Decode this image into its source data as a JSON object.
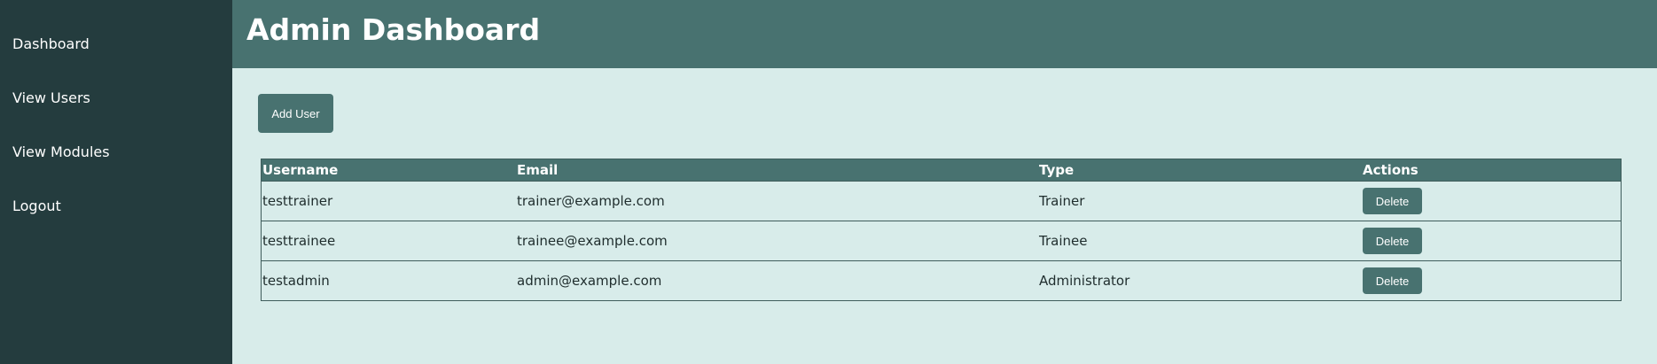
{
  "sidebar": {
    "items": [
      {
        "label": "Dashboard"
      },
      {
        "label": "View Users"
      },
      {
        "label": "View Modules"
      },
      {
        "label": "Logout"
      }
    ]
  },
  "header": {
    "title": "Admin Dashboard"
  },
  "toolbar": {
    "add_user_label": "Add User"
  },
  "table": {
    "columns": [
      "Username",
      "Email",
      "Type",
      "Actions"
    ],
    "rows": [
      {
        "username": "testtrainer",
        "email": "trainer@example.com",
        "type": "Trainer",
        "action_label": "Delete"
      },
      {
        "username": "testtrainee",
        "email": "trainee@example.com",
        "type": "Trainee",
        "action_label": "Delete"
      },
      {
        "username": "testadmin",
        "email": "admin@example.com",
        "type": "Administrator",
        "action_label": "Delete"
      }
    ]
  },
  "colors": {
    "sidebar_bg": "#243c3e",
    "header_bg": "#487270",
    "content_bg": "#d8ecea",
    "accent": "#487270"
  }
}
